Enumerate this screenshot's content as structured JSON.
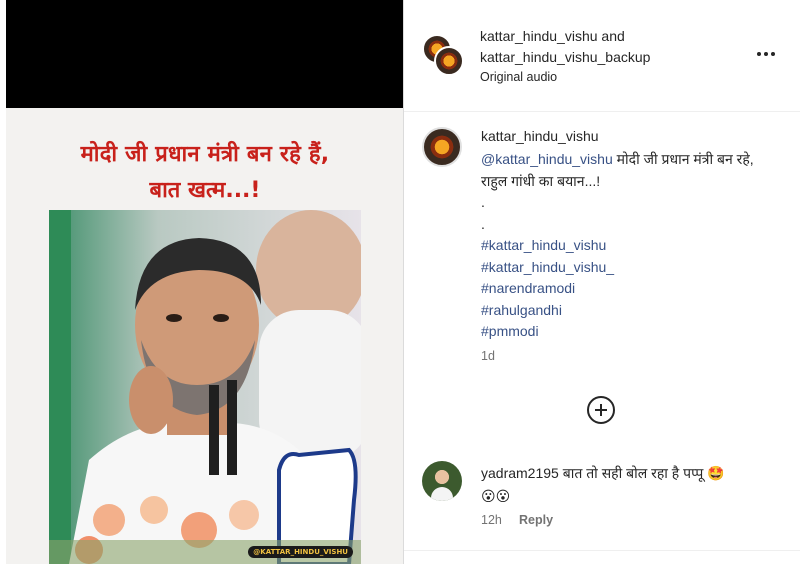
{
  "media": {
    "overlay_line1": "मोदी जी प्रधान मंत्री बन रहे हैं,",
    "overlay_line2": "बात खत्म...!",
    "watermark": "@KATTAR_HINDU_VISHU"
  },
  "header": {
    "user1": "kattar_hindu_vishu",
    "and_word": " and",
    "user2": "kattar_hindu_vishu_backup",
    "audio": "Original audio",
    "more_icon": "more-horizontal-icon"
  },
  "caption": {
    "username": "kattar_hindu_vishu",
    "mention": "@kattar_hindu_vishu",
    "text": " मोदी जी प्रधान मंत्री बन रहे, राहुल गांधी का बयान...!",
    "dot1": ".",
    "dot2": ".",
    "hashtags": [
      "#kattar_hindu_vishu",
      "#kattar_hindu_vishu_",
      "#narendramodi",
      "#rahulgandhi",
      "#pmmodi"
    ],
    "age": "1d"
  },
  "load_more_icon": "plus-circle-icon",
  "comment": {
    "username": "yadram2195",
    "text": " बात तो सही बोल रहा है पप्पू ",
    "emojis_line1": "🤩",
    "emojis_line2": "😮😮",
    "age": "12h",
    "reply_label": "Reply"
  },
  "colors": {
    "overlay_text": "#c8211b",
    "link": "#385185",
    "muted": "#737373",
    "text": "#262626"
  }
}
